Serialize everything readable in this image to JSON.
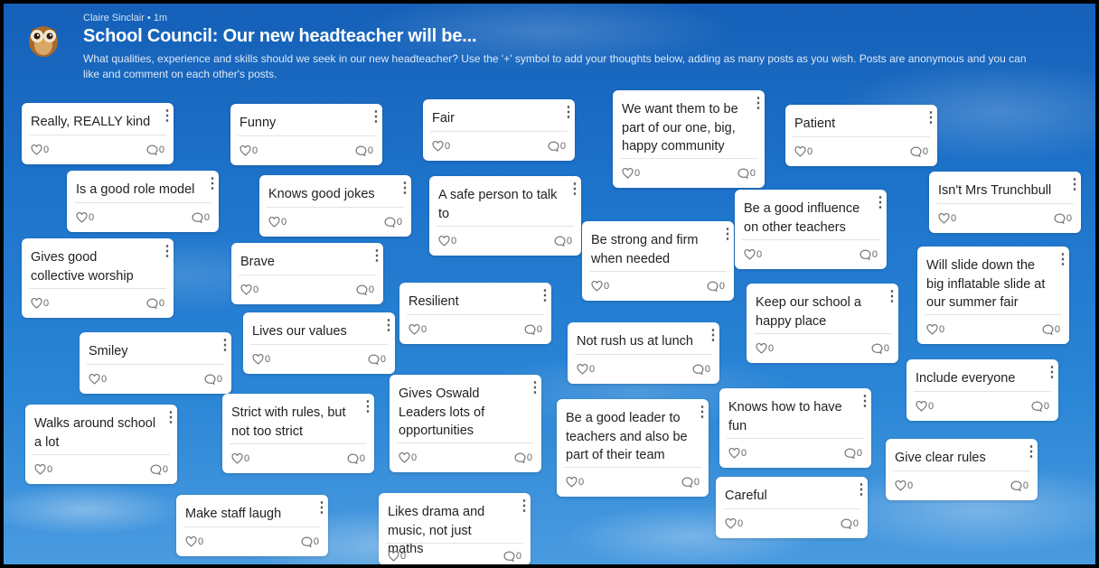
{
  "header": {
    "author": "Claire Sinclair • 1m",
    "title": "School Council: Our new headteacher will be...",
    "description": "What qualities, experience and skills should we seek in our new headteacher? Use the '+' symbol to add your thoughts below, adding as many posts as you wish. Posts are anonymous and you can like and comment on each other's posts.",
    "avatar_icon": "owl-icon"
  },
  "colors": {
    "sky_top": "#1560b8",
    "sky_bottom": "#4a9be0",
    "card_bg": "#ffffff"
  },
  "posts": [
    {
      "text": "Really, REALLY kind",
      "likes": "0",
      "comments": "0"
    },
    {
      "text": "Is a good role model",
      "likes": "0",
      "comments": "0"
    },
    {
      "text": "Gives good collective worship",
      "likes": "0",
      "comments": "0"
    },
    {
      "text": "Smiley",
      "likes": "0",
      "comments": "0"
    },
    {
      "text": "Walks around school a lot",
      "likes": "0",
      "comments": "0"
    },
    {
      "text": "Funny",
      "likes": "0",
      "comments": "0"
    },
    {
      "text": "Knows good jokes",
      "likes": "0",
      "comments": "0"
    },
    {
      "text": "Brave",
      "likes": "0",
      "comments": "0"
    },
    {
      "text": "Lives our values",
      "likes": "0",
      "comments": "0"
    },
    {
      "text": "Strict with rules, but not too strict",
      "likes": "0",
      "comments": "0"
    },
    {
      "text": "Make staff laugh",
      "likes": "0",
      "comments": "0"
    },
    {
      "text": "Fair",
      "likes": "0",
      "comments": "0"
    },
    {
      "text": "A safe person to talk to",
      "likes": "0",
      "comments": "0"
    },
    {
      "text": "Resilient",
      "likes": "0",
      "comments": "0"
    },
    {
      "text": "Gives Oswald Leaders lots of opportunities",
      "likes": "0",
      "comments": "0"
    },
    {
      "text": "Likes drama and music, not just maths",
      "likes": "0",
      "comments": "0"
    },
    {
      "text": "We want them to be part of our one, big, happy community",
      "likes": "0",
      "comments": "0"
    },
    {
      "text": "Be strong and firm when needed",
      "likes": "0",
      "comments": "0"
    },
    {
      "text": "Not rush us at lunch",
      "likes": "0",
      "comments": "0"
    },
    {
      "text": "Be a good leader to teachers and also be part of their team",
      "likes": "0",
      "comments": "0"
    },
    {
      "text": "Patient",
      "likes": "0",
      "comments": "0"
    },
    {
      "text": "Be a good influence on other teachers",
      "likes": "0",
      "comments": "0"
    },
    {
      "text": "Keep our school a happy place",
      "likes": "0",
      "comments": "0"
    },
    {
      "text": "Knows how to have fun",
      "likes": "0",
      "comments": "0"
    },
    {
      "text": "Careful",
      "likes": "0",
      "comments": "0"
    },
    {
      "text": "Isn't Mrs Trunchbull",
      "likes": "0",
      "comments": "0"
    },
    {
      "text": "Will slide down the big inflatable slide at our summer fair",
      "likes": "0",
      "comments": "0"
    },
    {
      "text": "Include everyone",
      "likes": "0",
      "comments": "0"
    },
    {
      "text": "Give clear rules",
      "likes": "0",
      "comments": "0"
    }
  ]
}
